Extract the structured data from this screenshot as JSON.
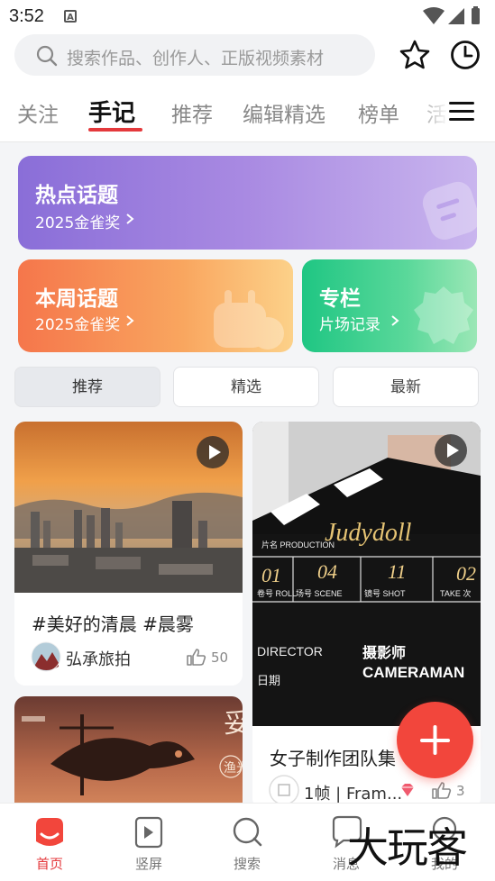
{
  "status_bar": {
    "time": "3:52",
    "a_icon": "A"
  },
  "search": {
    "placeholder": "搜索作品、创作人、正版视频素材"
  },
  "tabs": [
    {
      "label": "关注"
    },
    {
      "label": "手记"
    },
    {
      "label": "推荐"
    },
    {
      "label": "编辑精选"
    },
    {
      "label": "榜单"
    },
    {
      "label": "活"
    }
  ],
  "topic_cards": {
    "hot": {
      "title": "热点话题",
      "sub": "2025金雀奖"
    },
    "week": {
      "title": "本周话题",
      "sub": "2025金雀奖"
    },
    "column": {
      "title": "专栏",
      "sub": "片场记录"
    }
  },
  "segments": [
    {
      "label": "推荐"
    },
    {
      "label": "精选"
    },
    {
      "label": "最新"
    }
  ],
  "feed": [
    {
      "caption": "#美好的清晨 #晨雾",
      "author": "弘承旅拍",
      "likes": "50"
    },
    {
      "caption": "女子制作团队集",
      "author": "1帧 | Fram...",
      "likes": "3",
      "clapper_text": {
        "title": "Judydoll",
        "production": "片名 PRODUCTION",
        "roll": "卷号 ROLL",
        "scene": "场号 SCENE",
        "shot": "镜号 SHOT",
        "take": "TAKE 次",
        "num1": "01",
        "num2": "04",
        "num3": "11",
        "num4": "02",
        "director": "DIRECTOR",
        "date": "日期",
        "camera_cn": "摄影师",
        "camera_en": "CAMERAMAN"
      }
    },
    {
      "poster_text": "渔光",
      "poster_big": "妥"
    }
  ],
  "bottom_nav": [
    {
      "label": "首页"
    },
    {
      "label": "竖屏"
    },
    {
      "label": "搜索"
    },
    {
      "label": "消息"
    },
    {
      "label": "我的"
    }
  ],
  "watermark": "大玩客",
  "colors": {
    "accent": "#e4393c",
    "fab": "#f2463c",
    "hot": "#8a6ed8",
    "week": "#f5764b",
    "column": "#1fc683"
  }
}
